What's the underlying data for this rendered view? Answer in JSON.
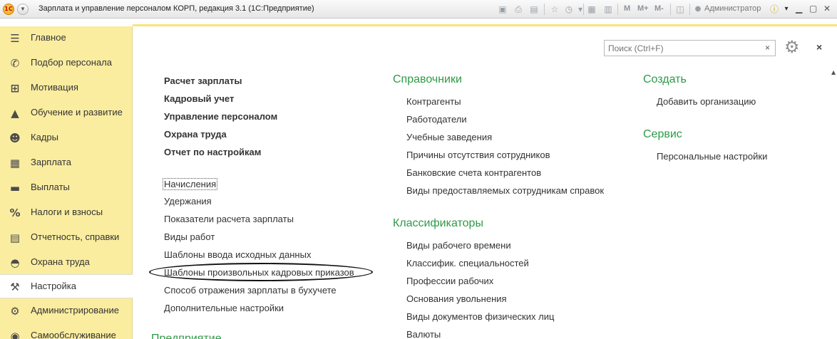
{
  "window": {
    "title": "Зарплата и управление персоналом КОРП, редакция 3.1  (1С:Предприятие)",
    "user": "Администратор",
    "memory_buttons": [
      "M",
      "M+",
      "M-"
    ]
  },
  "sidebar": {
    "items": [
      {
        "label": "Главное",
        "icon": "menu-lines-icon",
        "active": false
      },
      {
        "label": "Подбор персонала",
        "icon": "phone-icon",
        "active": false
      },
      {
        "label": "Мотивация",
        "icon": "gift-icon",
        "active": false
      },
      {
        "label": "Обучение и развитие",
        "icon": "graduation-cap-icon",
        "active": false
      },
      {
        "label": "Кадры",
        "icon": "people-icon",
        "active": false
      },
      {
        "label": "Зарплата",
        "icon": "calculator-icon",
        "active": false
      },
      {
        "label": "Выплаты",
        "icon": "wallet-icon",
        "active": false
      },
      {
        "label": "Налоги и взносы",
        "icon": "percent-icon",
        "active": false
      },
      {
        "label": "Отчетность, справки",
        "icon": "report-icon",
        "active": false
      },
      {
        "label": "Охрана труда",
        "icon": "helmet-icon",
        "active": false
      },
      {
        "label": "Настройка",
        "icon": "wrench-icon",
        "active": true
      },
      {
        "label": "Администрирование",
        "icon": "gear-icon",
        "active": false
      },
      {
        "label": "Самообслуживание",
        "icon": "self-service-icon",
        "active": false
      }
    ]
  },
  "search": {
    "placeholder": "Поиск (Ctrl+F)",
    "clear_label": "×"
  },
  "close_label": "×",
  "column1": {
    "bold_links": [
      "Расчет зарплаты",
      "Кадровый учет",
      "Управление персоналом",
      "Охрана труда",
      "Отчет по настройкам"
    ],
    "links": [
      "Начисления",
      "Удержания",
      "Показатели расчета зарплаты",
      "Виды работ",
      "Шаблоны ввода исходных данных",
      "Шаблоны произвольных кадровых приказов",
      "Способ отражения зарплаты в бухучете",
      "Дополнительные настройки"
    ],
    "section_partial": "Предприятие"
  },
  "column2": {
    "sections": [
      {
        "title": "Справочники",
        "items": [
          "Контрагенты",
          "Работодатели",
          "Учебные заведения",
          "Причины отсутствия сотрудников",
          "Банковские счета контрагентов",
          "Виды предоставляемых сотрудникам справок"
        ]
      },
      {
        "title": "Классификаторы",
        "items": [
          "Виды рабочего времени",
          "Классифик. специальностей",
          "Профессии рабочих",
          "Основания увольнения",
          "Виды документов физических лиц",
          "Валюты"
        ]
      }
    ]
  },
  "column3": {
    "sections": [
      {
        "title": "Создать",
        "items": [
          "Добавить организацию"
        ]
      },
      {
        "title": "Сервис",
        "items": [
          "Персональные настройки"
        ]
      }
    ]
  },
  "colors": {
    "sidebar_bg": "#fbeda0",
    "section_heading": "#2e9a48",
    "accent_line": "#fbe27a"
  }
}
